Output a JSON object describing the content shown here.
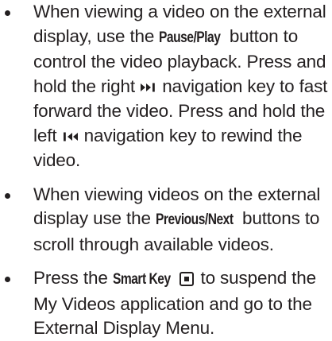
{
  "bullets": [
    {
      "part1": "When viewing a video on the external display, use the ",
      "key1": "Pause/Play",
      "part2": " button to control the video playback. Press and hold the right ",
      "icon1": "fast-forward-icon",
      "part3": " navigation key to fast forward the video. Press and hold the left ",
      "icon2": "rewind-icon",
      "part4": " navigation key to rewind the video."
    },
    {
      "part1": "When viewing videos on the external display use the ",
      "key1": "Previous/Next",
      "part2": " buttons to scroll through available videos."
    },
    {
      "part1": "Press the ",
      "key1": "Smart Key",
      "icon1": "smart-key-icon",
      "part2": " to suspend the My Videos application and go to the External Display Menu."
    }
  ]
}
